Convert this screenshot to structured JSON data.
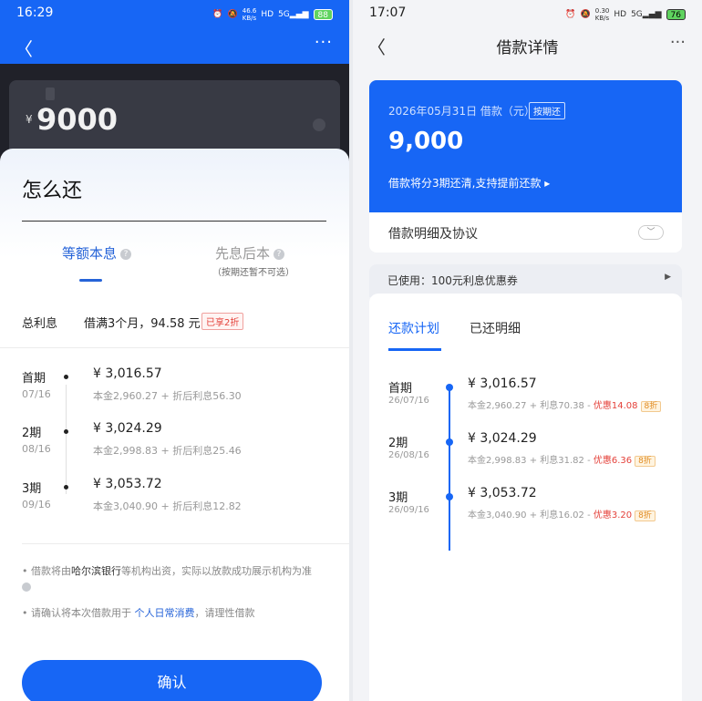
{
  "left": {
    "status": {
      "time": "16:29",
      "net": "46.6\nKB/s",
      "battery": "88"
    },
    "card": {
      "currency": "¥",
      "amount": "9000"
    },
    "sheet": {
      "title": "怎么还",
      "tabs": [
        {
          "label": "等额本息",
          "active": true
        },
        {
          "label": "先息后本",
          "sub": "（按期还暂不可选）",
          "active": false
        }
      ],
      "total_interest": {
        "label": "总利息",
        "value": "借满3个月，94.58 元",
        "badge": "已享2折"
      },
      "schedule": [
        {
          "period": "首期",
          "date": "07/16",
          "amount": "¥ 3,016.57",
          "detail": "本金2,960.27 + 折后利息56.30"
        },
        {
          "period": "2期",
          "date": "08/16",
          "amount": "¥ 3,024.29",
          "detail": "本金2,998.83 + 折后利息25.46"
        },
        {
          "period": "3期",
          "date": "09/16",
          "amount": "¥ 3,053.72",
          "detail": "本金3,040.90 + 折后利息12.82"
        }
      ],
      "note1_pre": "• 借款将由",
      "note1_bank": "哈尔滨银行",
      "note1_post": "等机构出资，实际以放款成功展示机构为准",
      "note2_pre": "• 请确认将本次借款用于 ",
      "note2_link": "个人日常消费",
      "note2_post": "，请理性借款",
      "confirm": "确认"
    }
  },
  "right": {
    "status": {
      "time": "17:07",
      "net": "0.30\nKB/s",
      "battery": "76"
    },
    "nav_title": "借款详情",
    "hero": {
      "date_line": "2026年05月31日 借款（元）",
      "tag": "按期还",
      "amount": "9,000",
      "sub": "借款将分3期还清,支持提前还款 ▸"
    },
    "detail_label": "借款明细及协议",
    "coupon": "已使用：100元利息优惠券",
    "tabs": [
      {
        "label": "还款计划",
        "active": true
      },
      {
        "label": "已还明细",
        "active": false
      }
    ],
    "schedule": [
      {
        "period": "首期",
        "date": "26/07/16",
        "amount": "¥ 3,016.57",
        "detail": "本金2,960.27 + 利息70.38 - ",
        "discount": "优惠14.08",
        "zhe": "8折"
      },
      {
        "period": "2期",
        "date": "26/08/16",
        "amount": "¥ 3,024.29",
        "detail": "本金2,998.83 + 利息31.82 - ",
        "discount": "优惠6.36",
        "zhe": "8折"
      },
      {
        "period": "3期",
        "date": "26/09/16",
        "amount": "¥ 3,053.72",
        "detail": "本金3,040.90 + 利息16.02 - ",
        "discount": "优惠3.20",
        "zhe": "8折"
      }
    ]
  }
}
